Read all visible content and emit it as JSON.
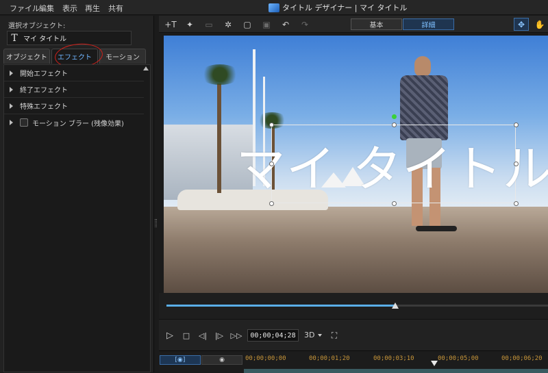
{
  "menu": {
    "items": [
      "ファイル",
      "編集",
      "表示",
      "再生",
      "共有"
    ],
    "window_title": "タイトル デザイナー | マイ タイトル"
  },
  "left_panel": {
    "selected_object_label": "選択オブジェクト:",
    "selected_object_value": "マイ タイトル",
    "tabs": [
      {
        "label": "オブジェクト",
        "active": false
      },
      {
        "label": "エフェクト",
        "active": true
      },
      {
        "label": "モーション",
        "active": false
      }
    ],
    "effects": [
      {
        "label": "開始エフェクト",
        "has_checkbox": false
      },
      {
        "label": "終了エフェクト",
        "has_checkbox": false
      },
      {
        "label": "特殊エフェクト",
        "has_checkbox": false
      },
      {
        "label": "モーション ブラー (残像効果)",
        "has_checkbox": true,
        "checked": false
      }
    ]
  },
  "toolbar": {
    "mode_basic": "基本",
    "mode_detail": "詳細",
    "active_mode": "詳細"
  },
  "preview": {
    "title_text": "マイ タイトル"
  },
  "playback": {
    "timecode": "00;00;04;28",
    "mode_3d": "3D",
    "progress": 0.6
  },
  "timeline": {
    "ruler_labels": [
      "00;00;00;00",
      "00;00;01;20",
      "00;00;03;10",
      "00;00;05;00",
      "00;00;06;20"
    ]
  },
  "colors": {
    "accent": "#5aaee8",
    "annotation": "#d0201a"
  }
}
